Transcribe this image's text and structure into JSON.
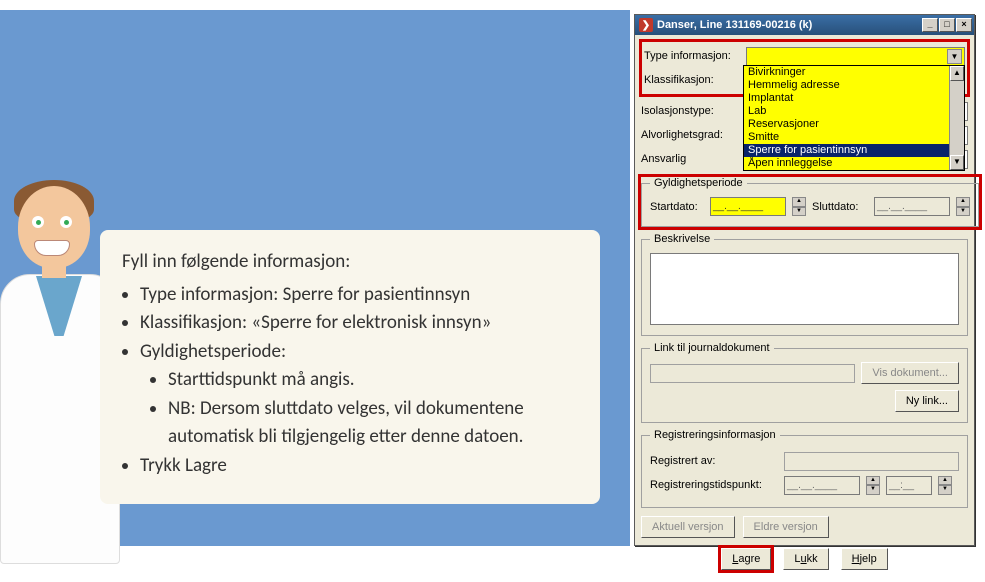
{
  "instructions": {
    "lead": "Fyll inn følgende informasjon:",
    "b1_label": "Type informasjon: ",
    "b1_val": "Sperre for pasientinnsyn",
    "b2_label": "Klassifikasjon: ",
    "b2_val": "«Sperre for elektronisk innsyn»",
    "b3": "Gyldighetsperiode:",
    "b3a": "Starttidspunkt må angis.",
    "b3b": "NB: Dersom sluttdato velges, vil dokumentene automatisk bli tilgjengelig etter denne datoen.",
    "b4": "Trykk Lagre"
  },
  "window": {
    "title": "Danser, Line  131169-00216 (k)"
  },
  "form": {
    "type_label": "Type informasjon:",
    "class_label": "Klassifikasjon:",
    "iso_label": "Isolasjonstype:",
    "sev_label": "Alvorlighetsgrad:",
    "resp_label": "Ansvarlig",
    "dropdown": {
      "o0": "Bivirkninger",
      "o1": "Hemmelig adresse",
      "o2": "Implantat",
      "o3": "Lab",
      "o4": "Reservasjoner",
      "o5": "Smitte",
      "o6": "Sperre for pasientinnsyn",
      "o7": "Åpen innleggelse"
    },
    "validity": {
      "legend": "Gyldighetsperiode",
      "start_label": "Startdato:",
      "end_label": "Sluttdato:",
      "mask": "__.__.____",
      "mask2": "__.__.____"
    },
    "desc_legend": "Beskrivelse",
    "link": {
      "legend": "Link til journaldokument",
      "show": "Vis dokument...",
      "new": "Ny link..."
    },
    "reg": {
      "legend": "Registreringsinformasjon",
      "by_label": "Registrert av:",
      "time_label": "Registreringstidspunkt:",
      "date_mask": "__.__.____",
      "time_mask": "__:__"
    },
    "ver": {
      "current": "Aktuell versjon",
      "older": "Eldre versjon"
    },
    "buttons": {
      "save": "Lagre",
      "close": "Lukk",
      "help": "Hjelp"
    }
  }
}
